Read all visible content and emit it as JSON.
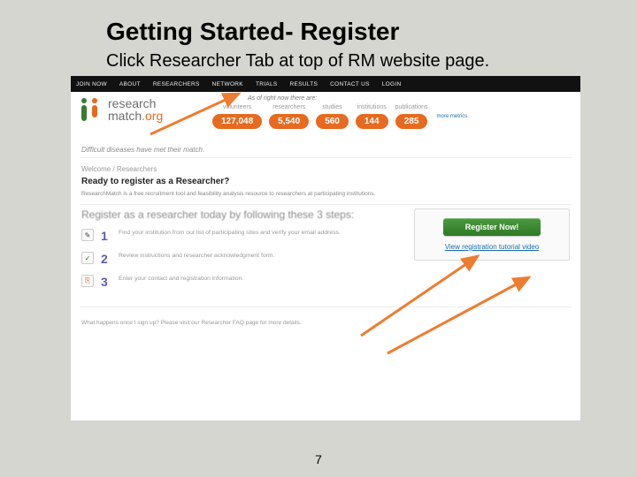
{
  "slide": {
    "title": "Getting Started- Register",
    "subtitle": "Click Researcher Tab at top of RM website page.",
    "page_number": "7"
  },
  "nav": {
    "items": [
      "JOIN NOW",
      "ABOUT",
      "RESEARCHERS",
      "NETWORK",
      "TRIALS",
      "RESULTS",
      "CONTACT US",
      "LOGIN"
    ]
  },
  "logo": {
    "line1": "research",
    "line2_plain": "match",
    "line2_accent": ".org"
  },
  "as_of": "As of right now there are:",
  "stats": [
    {
      "label": "volunteers",
      "value": "127,048"
    },
    {
      "label": "researchers",
      "value": "5,540"
    },
    {
      "label": "studies",
      "value": "560"
    },
    {
      "label": "institutions",
      "value": "144"
    },
    {
      "label": "publications",
      "value": "285"
    }
  ],
  "more_link": "more metrics",
  "tagline": "Difficult diseases have met their match.",
  "breadcrumb": "Welcome / Researchers",
  "heading_question": "Ready to register as a Researcher?",
  "intro_blurb": "ResearchMatch is a free recruitment tool and feasibility analysis resource to researchers at participating institutions.",
  "register_heading": "Register as a researcher today by following these 3 steps:",
  "steps": [
    {
      "icon": "pencil-icon",
      "glyph": "✎",
      "text": "Find your institution from our list of participating sites and verify your email address."
    },
    {
      "icon": "check-icon",
      "glyph": "✓",
      "text": "Review instructions and researcher acknowledgment form."
    },
    {
      "icon": "card-icon",
      "glyph": "⎘",
      "text": "Enter your contact and registration information."
    }
  ],
  "cta": {
    "button": "Register Now!",
    "link": "View registration tutorial video"
  },
  "footer_note": "What happens once I sign up? Please visit our Researcher FAQ page for more details.",
  "colors": {
    "accent_orange": "#e66a1f",
    "accent_green": "#3a7b32",
    "link_blue": "#1b6fae"
  }
}
